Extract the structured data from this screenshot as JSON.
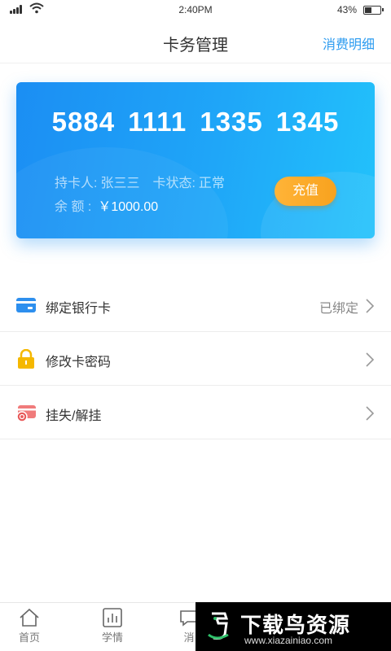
{
  "status_bar": {
    "time": "2:40PM",
    "battery": "43%"
  },
  "header": {
    "title": "卡务管理",
    "right_link": "消费明细"
  },
  "card": {
    "number": "5884 1111 1335 1345",
    "holder_label": "持卡人:",
    "holder_name": "张三三",
    "status_label": "卡状态:",
    "status_value": "正常",
    "balance_label": "余 额 :",
    "balance_value": "￥1000.00",
    "recharge_label": "充值"
  },
  "menu": [
    {
      "label": "绑定银行卡",
      "status": "已绑定",
      "icon": "bank-card-icon"
    },
    {
      "label": "修改卡密码",
      "status": "",
      "icon": "lock-icon"
    },
    {
      "label": "挂失/解挂",
      "status": "",
      "icon": "report-loss-icon"
    }
  ],
  "tabbar": {
    "tabs": [
      {
        "label": "首页",
        "icon": "home-icon"
      },
      {
        "label": "学情",
        "icon": "chart-icon"
      },
      {
        "label": "消",
        "icon": "message-icon"
      }
    ]
  },
  "watermark": {
    "title": "下载鸟资源",
    "url": "www.xiazainiao.com"
  },
  "colors": {
    "accent": "#2d9cf0",
    "card_start": "#1b8ef3",
    "card_end": "#22c2fb",
    "recharge": "#f8a21e"
  }
}
